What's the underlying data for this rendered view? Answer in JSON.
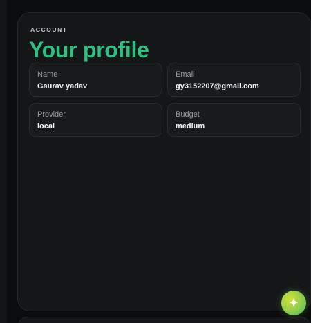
{
  "header": {
    "eyebrow": "ACCOUNT",
    "title": "Your profile"
  },
  "profile": {
    "fields": [
      {
        "label": "Name",
        "value": "Gaurav yadav"
      },
      {
        "label": "Email",
        "value": "gy3152207@gmail.com"
      },
      {
        "label": "Provider",
        "value": "local"
      },
      {
        "label": "Budget",
        "value": "medium"
      }
    ]
  },
  "fab": {
    "icon": "sparkle-icon",
    "glyph": "✦"
  },
  "colors": {
    "accent": "#2fbf82",
    "background": "#0b0c0d",
    "panel": "#151617"
  }
}
